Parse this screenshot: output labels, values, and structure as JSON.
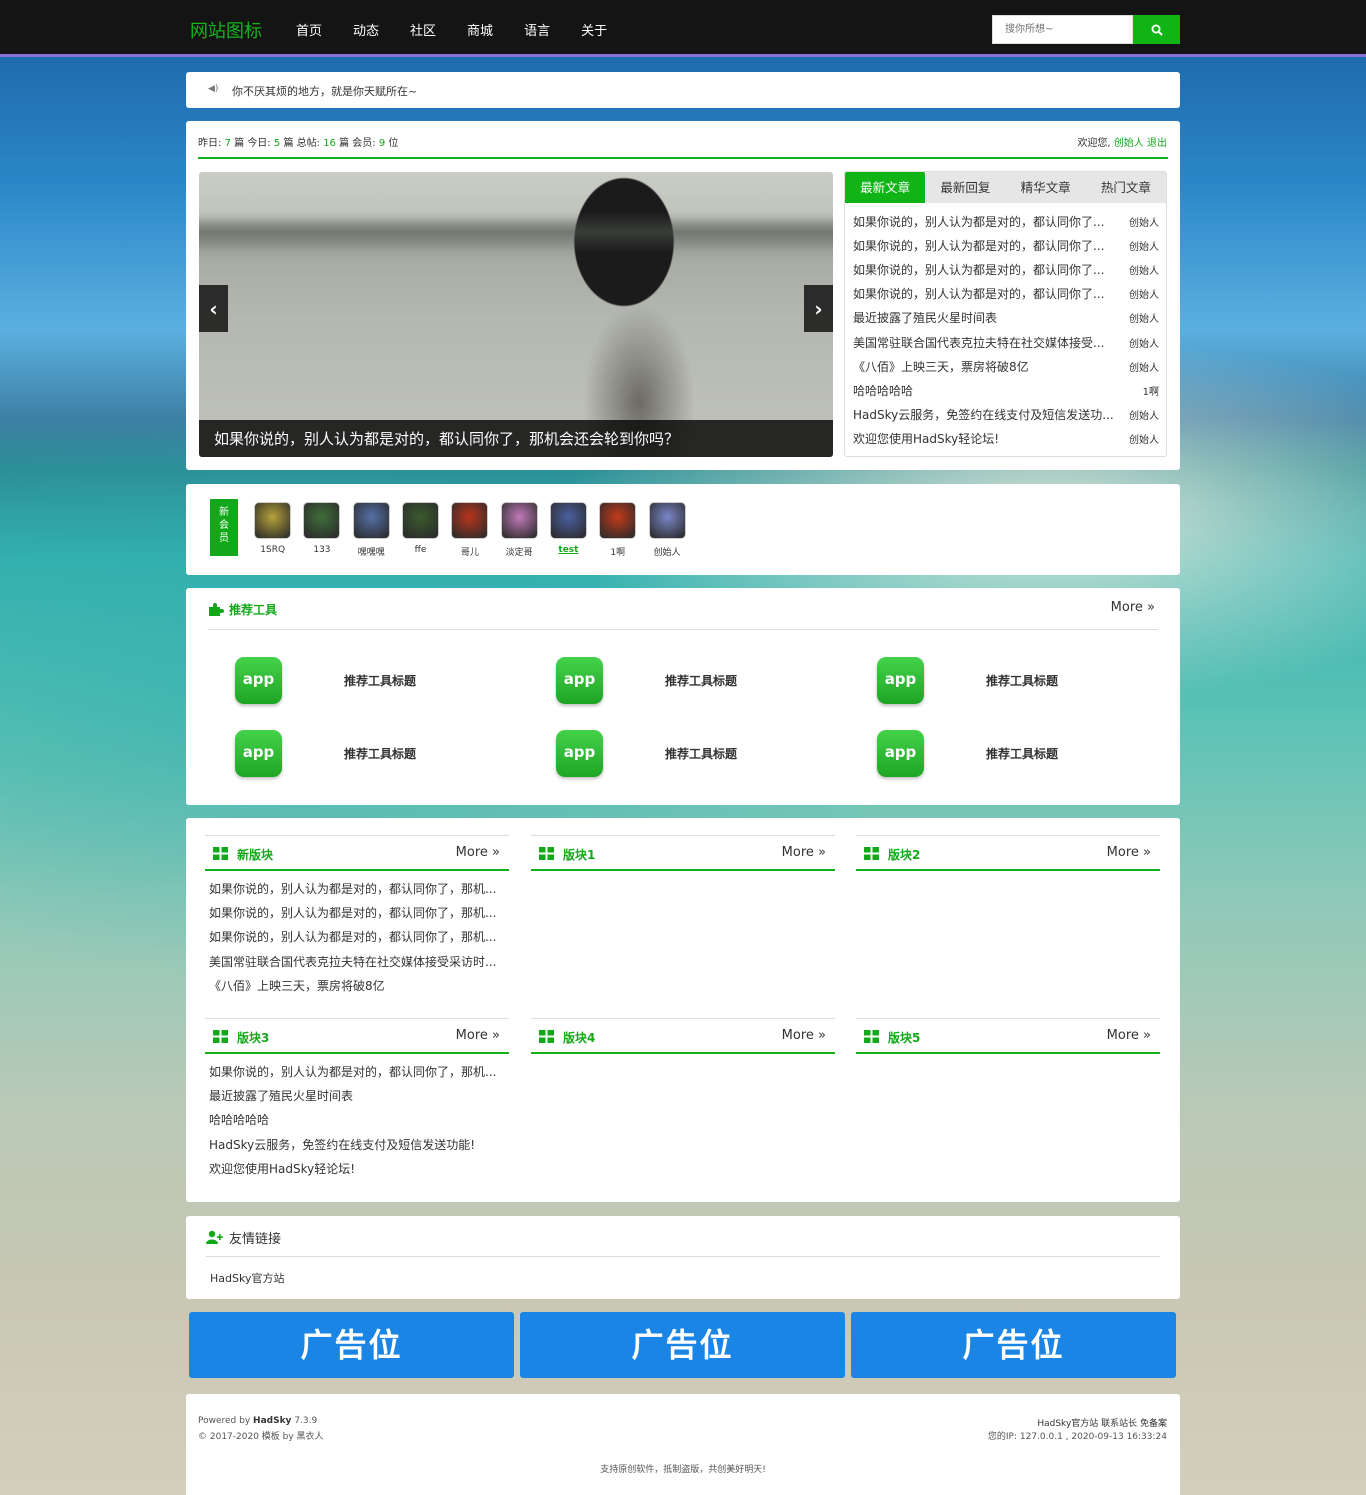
{
  "header": {
    "logo": "网站图标",
    "nav": [
      "首页",
      "动态",
      "社区",
      "商城",
      "语言",
      "关于"
    ],
    "search_placeholder": "搜你所想~",
    "search_icon": "search-icon"
  },
  "notice": {
    "icon": "speaker-icon",
    "text": "你不厌其烦的地方，就是你天赋所在~"
  },
  "stats": {
    "yesterday_label": "昨日:",
    "yesterday": "7",
    "yesterday_unit": "篇",
    "today_label": "今日:",
    "today": "5",
    "today_unit": "篇",
    "total_label": "总帖:",
    "total": "16",
    "total_unit": "篇",
    "members_label": "会员:",
    "members": "9",
    "members_unit": "位"
  },
  "welcome": {
    "text": "欢迎您,",
    "user": "创始人",
    "logout": "退出"
  },
  "slider": {
    "caption": "如果你说的，别人认为都是对的，都认同你了，那机会还会轮到你吗？",
    "prev": "‹",
    "next": "›"
  },
  "tabs": {
    "items": [
      "最新文章",
      "最新回复",
      "精华文章",
      "热门文章"
    ],
    "active": 0,
    "articles": [
      {
        "title": "如果你说的，别人认为都是对的，都认同你了...",
        "author": "创始人"
      },
      {
        "title": "如果你说的，别人认为都是对的，都认同你了...",
        "author": "创始人"
      },
      {
        "title": "如果你说的，别人认为都是对的，都认同你了...",
        "author": "创始人"
      },
      {
        "title": "如果你说的，别人认为都是对的，都认同你了...",
        "author": "创始人"
      },
      {
        "title": "最近披露了殖民火星时间表",
        "author": "创始人"
      },
      {
        "title": "美国常驻联合国代表克拉夫特在社交媒体接受...",
        "author": "创始人"
      },
      {
        "title": "《八佰》上映三天，票房将破8亿",
        "author": "创始人"
      },
      {
        "title": "哈哈哈哈哈",
        "author": "1啊"
      },
      {
        "title": "HadSky云服务，免签约在线支付及短信发送功...",
        "author": "创始人"
      },
      {
        "title": "欢迎您使用HadSky轻论坛!",
        "author": "创始人"
      }
    ]
  },
  "new_members": {
    "label": "新会员",
    "list": [
      {
        "name": "1SRQ",
        "color": "#b6a23a"
      },
      {
        "name": "133",
        "color": "#3f6e3a"
      },
      {
        "name": "嘿嘿嘿",
        "color": "#5570a8"
      },
      {
        "name": "ffe",
        "color": "#3a5a2e"
      },
      {
        "name": "哥儿",
        "color": "#b8351c"
      },
      {
        "name": "淡定哥",
        "color": "#c07ab8"
      },
      {
        "name": "test",
        "color": "#4b5fa0"
      },
      {
        "name": "1啊",
        "color": "#c23a1a"
      },
      {
        "name": "创始人",
        "color": "#7a86c8"
      }
    ]
  },
  "tools": {
    "title": "推荐工具",
    "more": "More »",
    "icon": "puzzle-icon",
    "items": [
      {
        "app": "app",
        "title": "推荐工具标题"
      },
      {
        "app": "app",
        "title": "推荐工具标题"
      },
      {
        "app": "app",
        "title": "推荐工具标题"
      },
      {
        "app": "app",
        "title": "推荐工具标题"
      },
      {
        "app": "app",
        "title": "推荐工具标题"
      },
      {
        "app": "app",
        "title": "推荐工具标题"
      }
    ]
  },
  "boards": [
    {
      "title": "新版块",
      "more": "More »",
      "posts": [
        "如果你说的，别人认为都是对的，都认同你了，那机...",
        "如果你说的，别人认为都是对的，都认同你了，那机...",
        "如果你说的，别人认为都是对的，都认同你了，那机...",
        "美国常驻联合国代表克拉夫特在社交媒体接受采访时...",
        "《八佰》上映三天，票房将破8亿"
      ]
    },
    {
      "title": "版块1",
      "more": "More »",
      "posts": []
    },
    {
      "title": "版块2",
      "more": "More »",
      "posts": []
    },
    {
      "title": "版块3",
      "more": "More »",
      "posts": [
        "如果你说的，别人认为都是对的，都认同你了，那机...",
        "最近披露了殖民火星时间表",
        "哈哈哈哈哈",
        "HadSky云服务，免签约在线支付及短信发送功能!",
        "欢迎您使用HadSky轻论坛!"
      ]
    },
    {
      "title": "版块4",
      "more": "More »",
      "posts": []
    },
    {
      "title": "版块5",
      "more": "More »",
      "posts": []
    }
  ],
  "links": {
    "title": "友情链接",
    "icon": "add-user-icon",
    "items": [
      "HadSky官方站"
    ]
  },
  "ads": [
    "广告位",
    "广告位",
    "广告位"
  ],
  "footer": {
    "powered": "Powered by",
    "product": "HadSky",
    "version": "7.3.9",
    "copyright": "© 2017-2020 模板 by 黑衣人",
    "right_links": "HadSky官方站 联系站长 免备案",
    "ip_line": "您的IP: 127.0.0.1 , 2020-09-13 16:33:24",
    "slogan": "支持原创软件，抵制盗版，共创美好明天!"
  },
  "colors": {
    "accent": "#13a81a",
    "topbar": "#141414",
    "ad": "#1a85e4"
  }
}
